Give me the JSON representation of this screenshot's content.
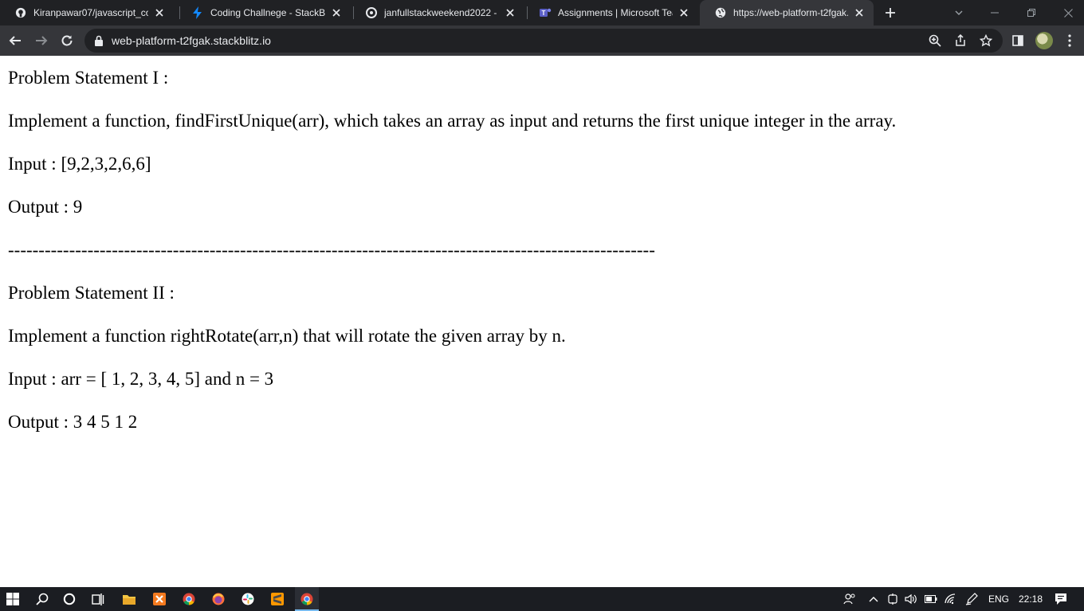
{
  "browser": {
    "tabs": [
      {
        "title": "Kiranpawar07/javascript_cod",
        "icon": "github-icon"
      },
      {
        "title": "Coding Challnege - StackBlit",
        "icon": "stackblitz-icon"
      },
      {
        "title": "janfullstackweekend2022 - R",
        "icon": "replit-icon"
      },
      {
        "title": "Assignments | Microsoft Tear",
        "icon": "teams-icon"
      },
      {
        "title": "https://web-platform-t2fgak.",
        "icon": "globe-icon"
      }
    ],
    "url": "web-platform-t2fgak.stackblitz.io"
  },
  "page": {
    "lines": [
      "Problem Statement I :",
      "Implement a function, findFirstUnique(arr), which takes an array as input and returns the first unique integer in the array.",
      "Input : [9,2,3,2,6,6]",
      "Output : 9",
      "----------------------------------------------------------------------------------------------------------",
      "Problem Statement II :",
      "Implement a function rightRotate(arr,n) that will rotate the given array by n.",
      "Input : arr = [ 1, 2, 3, 4, 5] and n = 3",
      "Output : 3 4 5 1 2"
    ]
  },
  "taskbar": {
    "language": "ENG",
    "time": "22:18"
  }
}
